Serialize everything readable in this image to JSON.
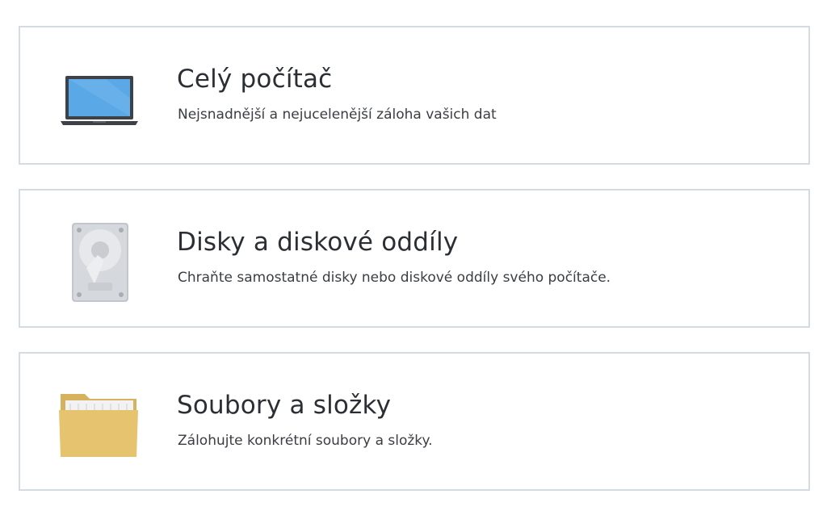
{
  "options": [
    {
      "title": "Celý počítač",
      "description": "Nejsnadnější a nejucelenější záloha vašich dat",
      "icon": "laptop-icon"
    },
    {
      "title": "Disky a diskové oddíly",
      "description": "Chraňte samostatné disky nebo diskové oddíly svého počítače.",
      "icon": "hard-drive-icon"
    },
    {
      "title": "Soubory a složky",
      "description": "Zálohujte konkrétní soubory a složky.",
      "icon": "folder-icon"
    }
  ],
  "colors": {
    "card_border": "#d4dbe4",
    "laptop_screen": "#5aa9e6",
    "drive_body": "#c9ccd1",
    "folder": "#e6c36e"
  }
}
